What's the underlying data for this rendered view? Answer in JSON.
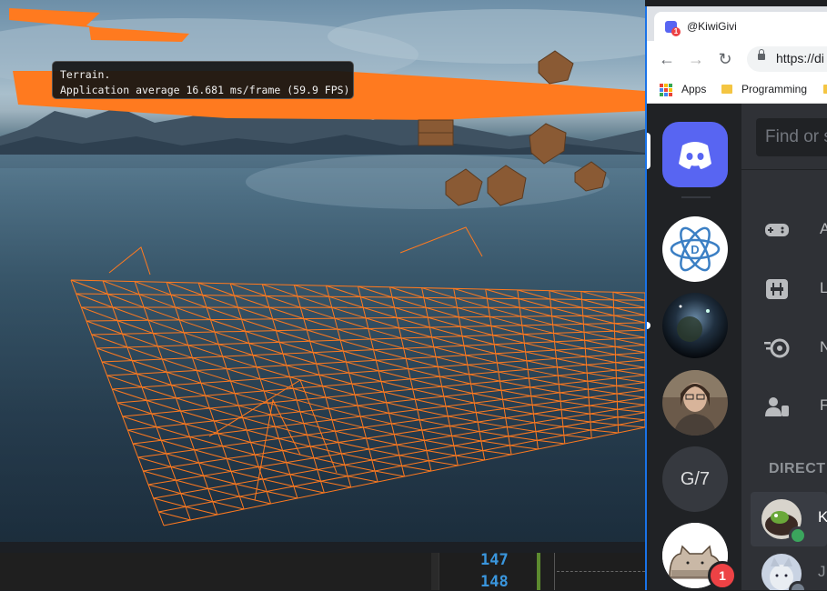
{
  "viewport": {
    "hud": {
      "line1": "Terrain.",
      "line2": "Application average 16.681 ms/frame (59.9 FPS)"
    },
    "wireframe_color": "#ff7a1f"
  },
  "editor": {
    "line_numbers": [
      "147",
      "148"
    ],
    "line_number_color": "#3a96dd"
  },
  "browser": {
    "tab": {
      "title": "@KiwiGivi",
      "badge": "1"
    },
    "nav": {
      "back_icon": "arrow-left-icon",
      "forward_icon": "arrow-right-icon",
      "reload_icon": "reload-icon",
      "url": "https://di"
    },
    "bookmarks": {
      "apps": "Apps",
      "programming": "Programming"
    }
  },
  "discord": {
    "brand_color": "#5865f2",
    "servers": [
      {
        "name": "home",
        "icon": "discord-logo-icon"
      },
      {
        "name": "atom-server",
        "icon": "atom-icon",
        "letter": "D"
      },
      {
        "name": "space-server"
      },
      {
        "name": "person-server"
      },
      {
        "name": "text-server",
        "label": "G/7"
      },
      {
        "name": "pusheen-server",
        "badge": "1"
      }
    ],
    "search_placeholder": "Find or s",
    "nav_items": [
      {
        "icon": "gamepad-icon",
        "label": "A"
      },
      {
        "icon": "library-icon",
        "label": "L"
      },
      {
        "icon": "nitro-icon",
        "label": "N"
      },
      {
        "icon": "friends-icon",
        "label": "F"
      }
    ],
    "dm_header": "DIRECT",
    "dm_rows": [
      {
        "name": "K",
        "status": "online",
        "status_color": "#3ba55d"
      },
      {
        "name": "J",
        "status": "offline",
        "status_color": "#747f8d"
      }
    ]
  }
}
